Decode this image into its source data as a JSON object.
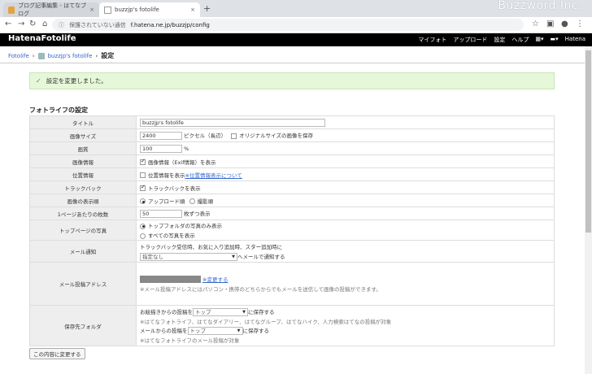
{
  "browser": {
    "tabs": [
      {
        "label": "ブログ記事編集 - はてなブログ",
        "close": "×"
      },
      {
        "label": "buzzjp's fotolife",
        "close": "×"
      }
    ],
    "new_tab": "+",
    "brand": "Buzzword Inc.",
    "security": "保護されていない通信",
    "url": "f.hatena.ne.jp/buzzjp/config"
  },
  "header": {
    "logo": "HatenaFotolife",
    "menu": [
      "マイフォト",
      "アップロード",
      "設定",
      "ヘルプ"
    ],
    "hatena": "Hatena"
  },
  "breadcrumb": {
    "root": "Fotolife",
    "user": "buzzjp's fotolife",
    "current": "設定"
  },
  "notice": "設定を変更しました。",
  "section_title": "フォトライフの設定",
  "settings": {
    "title_label": "タイトル",
    "title_value": "buzzjp's fotolife",
    "size_label": "画像サイズ",
    "size_value": "2400",
    "size_unit": "ピクセル（長辺）",
    "size_original": "オリジナルサイズの画像を保存",
    "quality_label": "画質",
    "quality_value": "100",
    "quality_unit": "%",
    "info_label": "画像情報",
    "info_text": "画像情報（Exif情報）を表示",
    "geo_label": "位置情報",
    "geo_text": "位置情報を表示",
    "geo_link": "※位置情報表示について",
    "trackback_label": "トラックバック",
    "trackback_text": "トラックバックを表示",
    "order_label": "画像の表示順",
    "order_upload": "アップロード順",
    "order_shot": "撮影順",
    "perpage_label": "1ページあたりの枚数",
    "perpage_value": "50",
    "perpage_unit": "枚ずつ表示",
    "top_label": "トップページの写真",
    "top_opt1": "トップフォルダの写真のみ表示",
    "top_opt2": "すべての写真を表示",
    "mail_label": "メール通知",
    "mail_text": "トラックバック受信時、お気に入り追加時、スター追加時に",
    "mail_select": "指定なし",
    "mail_suffix": "へメールで通知する",
    "post_label": "メール投稿アドレス",
    "post_link": "※変更する",
    "post_note": "※メール投稿アドレスにはパソコン・携帯のどちらからでもメールを送信して画像の投稿ができます。",
    "folder_label": "保存先フォルダ",
    "folder_prefix1": "お絵描きからの投稿を",
    "folder_select1": "トップ",
    "folder_suffix": "に保存する",
    "folder_note1": "※はてなフォトライフ、はてなダイアリー、はてなグループ、はてなハイク、人力検索はてなの投稿が対象",
    "folder_prefix2": "メールからの投稿を",
    "folder_select2": "トップ",
    "folder_note2": "※はてなフォトライフのメール投稿が対象"
  },
  "submit": "この内容に変更する"
}
